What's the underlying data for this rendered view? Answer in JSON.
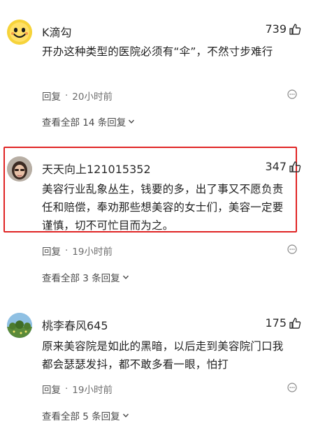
{
  "comments": [
    {
      "username": "K滴勾",
      "likes": "739",
      "text": "开办这种类型的医院必须有“伞”，不然寸步难行",
      "reply_label": "回复",
      "separator": "·",
      "time": "20小时前",
      "view_all": "查看全部 14 条回复"
    },
    {
      "username": "天天向上121015352",
      "likes": "347",
      "text": "美容行业乱象丛生，钱要的多，出了事又不愿负责任和赔偿，奉劝那些想美容的女士们，美容一定要谨慎，切不可忙目而为之。",
      "reply_label": "回复",
      "separator": "·",
      "time": "19小时前",
      "view_all": "查看全部 3 条回复"
    },
    {
      "username": "桃李春风645",
      "likes": "175",
      "text": "原来美容院是如此的黑暗，以后走到美容院门口我都会瑟瑟发抖，都不敢多看一眼，怕打",
      "reply_label": "回复",
      "separator": "·",
      "time": "19小时前",
      "view_all": "查看全部 5 条回复"
    }
  ],
  "colors": {
    "highlight_border": "#e02424",
    "meta_text": "#6d6d6d"
  }
}
